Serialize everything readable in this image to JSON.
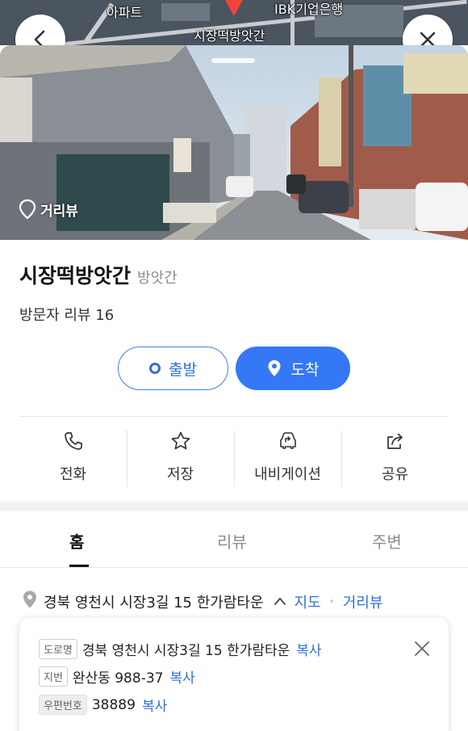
{
  "map": {
    "labels": {
      "apartment": "아파트",
      "bank": "IBK기업은행",
      "place": "시장떡방앗간"
    },
    "back_icon": "chevron-left-icon",
    "close_icon": "close-icon",
    "pin_color": "#f04438"
  },
  "photo": {
    "badge_label": "거리뷰",
    "badge_icon": "location-outline-icon"
  },
  "place": {
    "name": "시장떡방앗간",
    "category": "방앗간",
    "visitor_review": "방문자 리뷰 16"
  },
  "route_buttons": {
    "depart_label": "출발",
    "arrive_label": "도착",
    "accent": "#3478f6"
  },
  "actions": [
    {
      "label": "전화",
      "icon": "phone-icon"
    },
    {
      "label": "저장",
      "icon": "star-icon"
    },
    {
      "label": "내비게이션",
      "icon": "car-navigation-icon"
    },
    {
      "label": "공유",
      "icon": "share-icon"
    }
  ],
  "tabs": [
    {
      "label": "홈",
      "active": true
    },
    {
      "label": "리뷰",
      "active": false
    },
    {
      "label": "주변",
      "active": false
    }
  ],
  "address": {
    "summary": "경북 영천시 시장3길 15 한가람타운",
    "map_link": "지도",
    "roadview_link": "거리뷰",
    "card": {
      "road_tag": "도로명",
      "road_address": "경북 영천시 시장3길 15 한가람타운",
      "lot_tag": "지번",
      "lot_address": "완산동 988-37",
      "postal_tag": "우편번호",
      "postal_code": "38889",
      "copy_label": "복사"
    }
  }
}
